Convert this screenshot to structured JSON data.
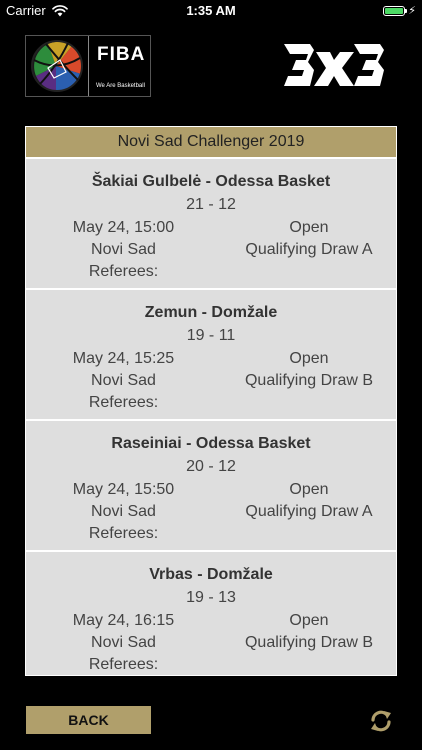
{
  "status": {
    "carrier": "Carrier",
    "time": "1:35 AM"
  },
  "header": {
    "fiba_word": "FIBA",
    "fiba_slogan": "We Are Basketball"
  },
  "tournament": {
    "title": "Novi Sad Challenger 2019"
  },
  "matches": [
    {
      "teams": "Šakiai Gulbelė - Odessa Basket",
      "score": "21 - 12",
      "datetime": "May 24, 15:00",
      "category": "Open",
      "venue": "Novi Sad",
      "stage": "Qualifying Draw A",
      "referees_label": "Referees:"
    },
    {
      "teams": "Zemun - Domžale",
      "score": "19 - 11",
      "datetime": "May 24, 15:25",
      "category": "Open",
      "venue": "Novi Sad",
      "stage": "Qualifying Draw B",
      "referees_label": "Referees:"
    },
    {
      "teams": "Raseiniai - Odessa Basket",
      "score": "20 - 12",
      "datetime": "May 24, 15:50",
      "category": "Open",
      "venue": "Novi Sad",
      "stage": "Qualifying Draw A",
      "referees_label": "Referees:"
    },
    {
      "teams": "Vrbas - Domžale",
      "score": "19 - 13",
      "datetime": "May 24, 16:15",
      "category": "Open",
      "venue": "Novi Sad",
      "stage": "Qualifying Draw B",
      "referees_label": "Referees:"
    }
  ],
  "footer": {
    "back_label": "BACK"
  },
  "colors": {
    "gold": "#b09f6b",
    "card": "#dedede",
    "background": "#000000"
  },
  "icons": {
    "wifi": "wifi-icon",
    "battery": "battery-icon",
    "refresh": "refresh-icon"
  }
}
